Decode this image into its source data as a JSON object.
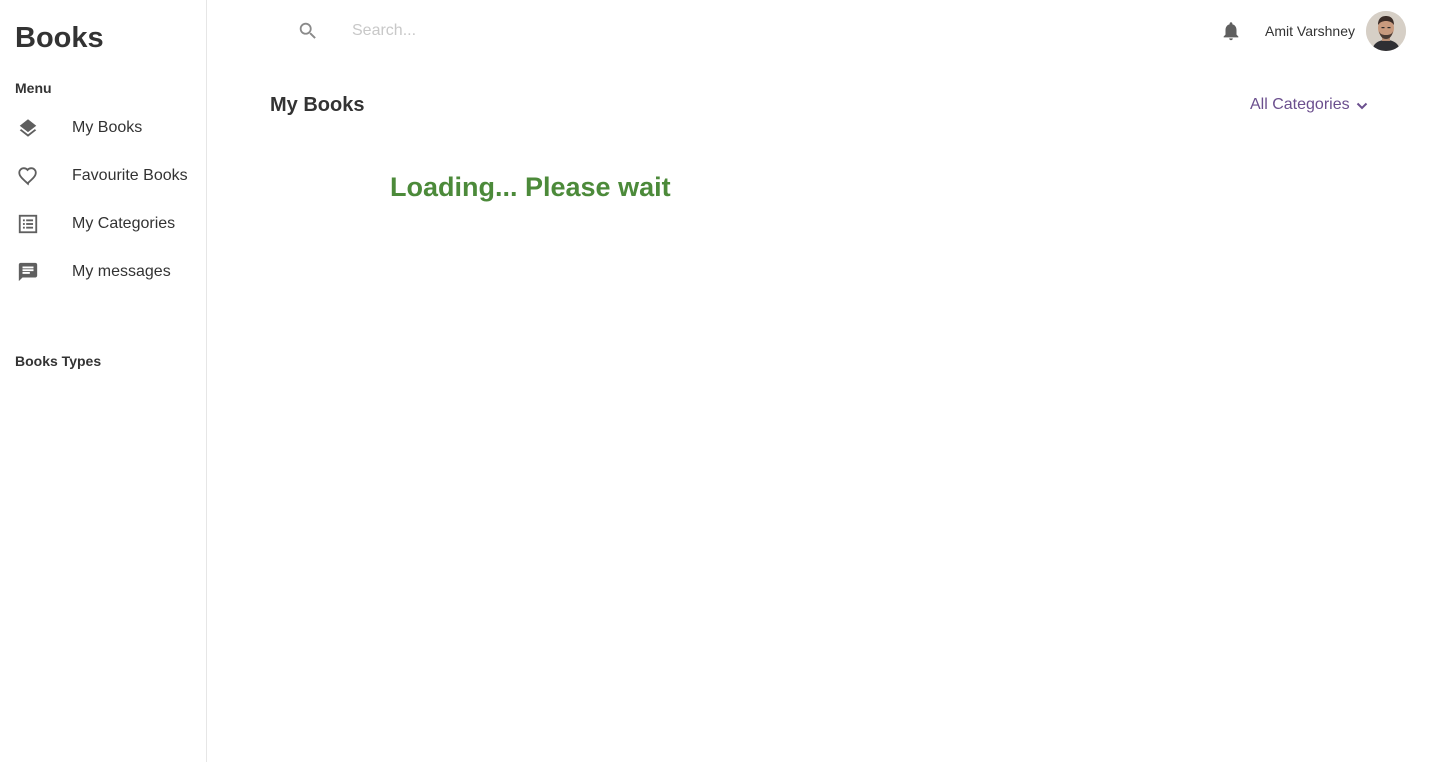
{
  "app": {
    "brand": "Books"
  },
  "sidebar": {
    "menu_heading": "Menu",
    "items": [
      {
        "label": "My Books",
        "icon": "layers-icon"
      },
      {
        "label": "Favourite Books",
        "icon": "heart-icon"
      },
      {
        "label": "My Categories",
        "icon": "list-icon"
      },
      {
        "label": "My messages",
        "icon": "message-icon"
      }
    ],
    "types_heading": "Books Types"
  },
  "header": {
    "search_placeholder": "Search...",
    "search_value": "",
    "user_name": "Amit Varshney",
    "notification_icon": "bell-icon"
  },
  "main": {
    "title": "My Books",
    "category_filter": "All Categories",
    "loading_text": "Loading... Please wait"
  },
  "colors": {
    "accent_purple": "#6b4f8e",
    "loading_green": "#4c8a3a",
    "text": "#333333",
    "icon_grey": "#5f5f5f"
  }
}
